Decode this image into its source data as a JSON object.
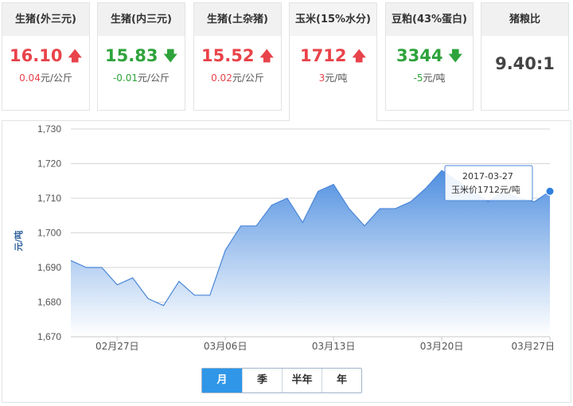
{
  "tabs": [
    {
      "name": "生猪(外三元)",
      "price": "16.10",
      "direction": "up",
      "change": "0.04",
      "unit": "元/公斤"
    },
    {
      "name": "生猪(内三元)",
      "price": "15.83",
      "direction": "down",
      "change": "-0.01",
      "unit": "元/公斤"
    },
    {
      "name": "生猪(土杂猪)",
      "price": "15.52",
      "direction": "up",
      "change": "0.02",
      "unit": "元/公斤"
    },
    {
      "name": "玉米(15%水分)",
      "price": "1712",
      "direction": "up",
      "change": "3",
      "unit": "元/吨",
      "active": true
    },
    {
      "name": "豆粕(43%蛋白)",
      "price": "3344",
      "direction": "down",
      "change": "-5",
      "unit": "元/吨"
    },
    {
      "name": "猪粮比",
      "price": "9.40:1",
      "direction": "none",
      "change": "",
      "unit": ""
    }
  ],
  "arrows": {
    "up": "🡅",
    "down": "🡇"
  },
  "colors": {
    "up": "#e8434a",
    "down": "#2ea33b",
    "area_top": "#4f8fe0",
    "area_bottom": "#ffffff",
    "line": "#4a86d8",
    "point": "#2f80e0"
  },
  "range_buttons": [
    {
      "label": "月",
      "active": true
    },
    {
      "label": "季",
      "active": false
    },
    {
      "label": "半年",
      "active": false
    },
    {
      "label": "年",
      "active": false
    }
  ],
  "chart_data": {
    "type": "area",
    "ylabel": "元/吨",
    "ylim": [
      1670,
      1730
    ],
    "yticks": [
      1670,
      1680,
      1690,
      1700,
      1710,
      1720,
      1730
    ],
    "ytick_labels": [
      "1,670",
      "1,680",
      "1,690",
      "1,700",
      "1,710",
      "1,720",
      "1,730"
    ],
    "x": [
      "2017-02-24",
      "2017-02-25",
      "2017-02-26",
      "2017-02-27",
      "2017-02-28",
      "2017-03-01",
      "2017-03-02",
      "2017-03-03",
      "2017-03-04",
      "2017-03-05",
      "2017-03-06",
      "2017-03-07",
      "2017-03-08",
      "2017-03-09",
      "2017-03-10",
      "2017-03-11",
      "2017-03-12",
      "2017-03-13",
      "2017-03-14",
      "2017-03-15",
      "2017-03-16",
      "2017-03-17",
      "2017-03-18",
      "2017-03-19",
      "2017-03-20",
      "2017-03-21",
      "2017-03-22",
      "2017-03-23",
      "2017-03-24",
      "2017-03-25",
      "2017-03-26",
      "2017-03-27"
    ],
    "series": [
      {
        "values": [
          1692,
          1690,
          1690,
          1685,
          1687,
          1681,
          1679,
          1686,
          1682,
          1682,
          1695,
          1702,
          1702,
          1708,
          1710,
          1703,
          1712,
          1714,
          1707,
          1702,
          1707,
          1707,
          1709,
          1713,
          1718,
          1715,
          1712,
          1709,
          1712,
          1710,
          1709,
          1712
        ]
      }
    ],
    "xtick_labels": [
      {
        "date": "2017-02-27",
        "label": "02月27日"
      },
      {
        "date": "2017-03-06",
        "label": "03月06日"
      },
      {
        "date": "2017-03-13",
        "label": "03月13日"
      },
      {
        "date": "2017-03-20",
        "label": "03月20日"
      },
      {
        "date": "2017-03-27",
        "label": "03月27日"
      }
    ],
    "grid": true,
    "tooltip": {
      "date": "2017-03-27",
      "text": "玉米价1712元/吨"
    }
  }
}
